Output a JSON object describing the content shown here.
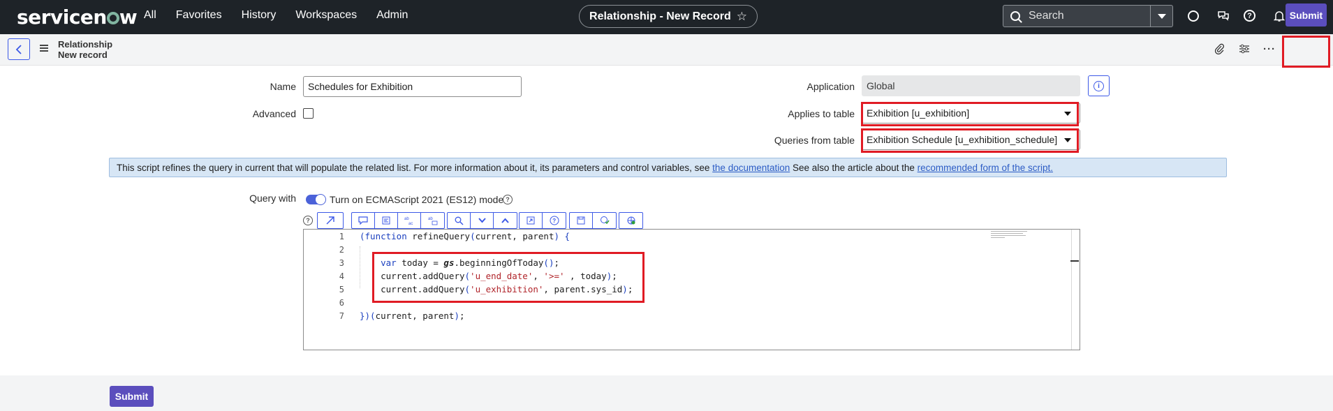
{
  "nav": {
    "brand": "servicenow",
    "links": [
      "All",
      "Favorites",
      "History",
      "Workspaces",
      "Admin"
    ],
    "record_title": "Relationship - New Record",
    "search_placeholder": "Search"
  },
  "header": {
    "breadcrumb_title": "Relationship",
    "breadcrumb_sub": "New record",
    "submit_label": "Submit"
  },
  "form": {
    "name_label": "Name",
    "name_value": "Schedules for Exhibition",
    "advanced_label": "Advanced",
    "application_label": "Application",
    "application_value": "Global",
    "applies_label": "Applies to table",
    "applies_value": "Exhibition [u_exhibition]",
    "queries_label": "Queries from table",
    "queries_value": "Exhibition Schedule [u_exhibition_schedule]",
    "info_text": "This script refines the query in current that will populate the related list. For more information about it, its parameters and control variables, see",
    "info_link1": "the documentation",
    "info_mid": "See also the article about the",
    "info_link2": "recommended form of the script.",
    "query_label": "Query with",
    "es_toggle_label": "Turn on ECMAScript 2021 (ES12) mode"
  },
  "editor": {
    "line_numbers": [
      "1",
      "2",
      "3",
      "4",
      "5",
      "6",
      "7"
    ]
  },
  "footer": {
    "submit_label": "Submit"
  },
  "colors": {
    "nav_bg": "#1e2328",
    "accent": "#5b4ebd",
    "highlight": "#e01b24",
    "info_bg": "#d7e6f5"
  }
}
